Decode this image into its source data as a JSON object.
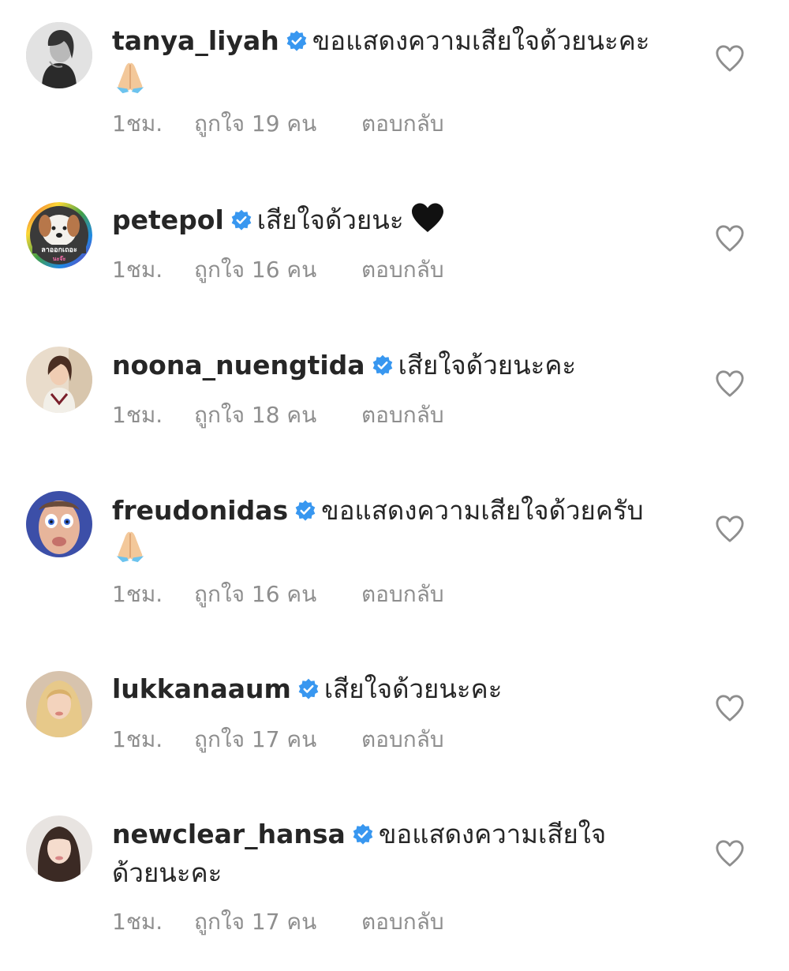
{
  "comments": [
    {
      "username": "tanya_liyah",
      "text": "ขอแสดงความเสียใจด้วยนะคะ",
      "text_cont": "",
      "emoji": "folded-hands",
      "time": "1ชม.",
      "likes": "ถูกใจ 19 คน",
      "reply": "ตอบกลับ"
    },
    {
      "username": "petepol",
      "text": "เสียใจด้วยนะ",
      "text_cont": "",
      "emoji": "black-heart",
      "avatar_caption": "ลาออกเถอะ",
      "avatar_caption2": "นะจ๊ะ",
      "time": "1ชม.",
      "likes": "ถูกใจ 16 คน",
      "reply": "ตอบกลับ"
    },
    {
      "username": "noona_nuengtida",
      "text": "เสียใจด้วยนะคะ",
      "text_cont": "",
      "emoji": "",
      "time": "1ชม.",
      "likes": "ถูกใจ 18 คน",
      "reply": "ตอบกลับ"
    },
    {
      "username": "freudonidas",
      "text": "ขอแสดงความเสียใจด้วยครับ",
      "text_cont": "",
      "emoji": "folded-hands",
      "time": "1ชม.",
      "likes": "ถูกใจ 16 คน",
      "reply": "ตอบกลับ"
    },
    {
      "username": "lukkanaaum",
      "text": "เสียใจด้วยนะคะ",
      "text_cont": "",
      "emoji": "",
      "time": "1ชม.",
      "likes": "ถูกใจ 17 คน",
      "reply": "ตอบกลับ"
    },
    {
      "username": "newclear_hansa",
      "text": "ขอแสดงความเสียใจ",
      "text_cont": "ด้วยนะคะ",
      "emoji": "",
      "time": "1ชม.",
      "likes": "ถูกใจ 17 คน",
      "reply": "ตอบกลับ"
    }
  ],
  "colors": {
    "username": "#262626",
    "meta": "#8e8e8e",
    "verified": "#3897f0",
    "heart_outline": "#8e8e8e"
  },
  "icons": {
    "verified": "verified-badge-icon",
    "like": "heart-outline-icon"
  }
}
